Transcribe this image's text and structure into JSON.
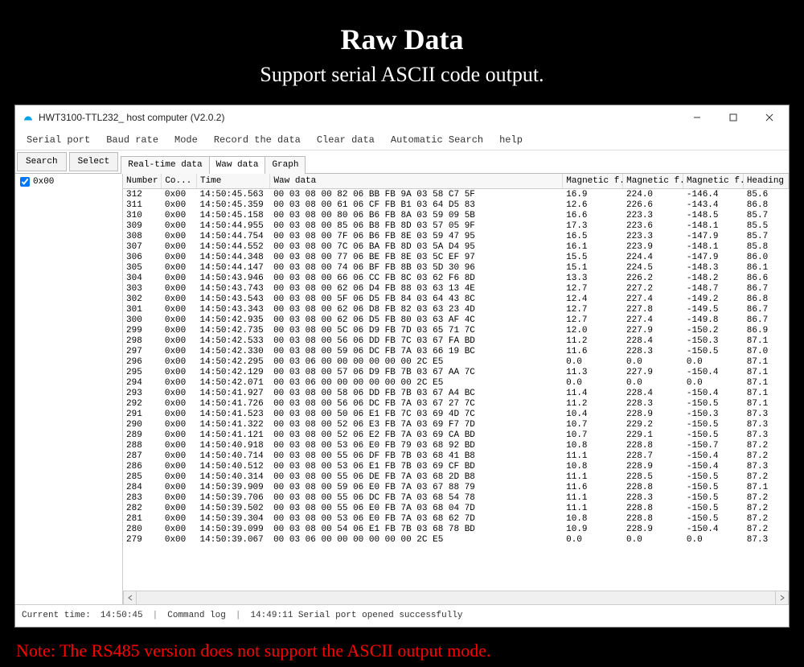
{
  "page": {
    "title": "Raw Data",
    "subtitle": "Support serial ASCII code output.",
    "footer_note": "Note: The RS485 version does not support the ASCII output mode."
  },
  "window": {
    "title": "HWT3100-TTL232_ host computer (V2.0.2)"
  },
  "menu": {
    "serial_port": "Serial port",
    "baud_rate": "Baud rate",
    "mode": "Mode",
    "record": "Record the data",
    "clear": "Clear data",
    "auto_search": "Automatic Search",
    "help": "help"
  },
  "toolbar": {
    "search": "Search",
    "select": "Select"
  },
  "tabs": {
    "realtime": "Real-time data",
    "raw": "Waw data",
    "graph": "Graph"
  },
  "side": {
    "checkbox_label": "0x00",
    "checked": true
  },
  "table": {
    "headers": {
      "number": "Number",
      "co": "Co...",
      "time": "Time",
      "raw": "Waw data",
      "mag1": "Magnetic f...",
      "mag2": "Magnetic f...",
      "mag3": "Magnetic f...",
      "heading": "Heading"
    },
    "rows": [
      {
        "number": "312",
        "co": "0x00",
        "time": "14:50:45.563",
        "raw": "00 03 08 00 82 06 BB FB 9A 03 58 C7 5F",
        "m1": "16.9",
        "m2": "224.0",
        "m3": "-146.4",
        "h": "85.6"
      },
      {
        "number": "311",
        "co": "0x00",
        "time": "14:50:45.359",
        "raw": "00 03 08 00 61 06 CF FB B1 03 64 D5 83",
        "m1": "12.6",
        "m2": "226.6",
        "m3": "-143.4",
        "h": "86.8"
      },
      {
        "number": "310",
        "co": "0x00",
        "time": "14:50:45.158",
        "raw": "00 03 08 00 80 06 B6 FB 8A 03 59 09 5B",
        "m1": "16.6",
        "m2": "223.3",
        "m3": "-148.5",
        "h": "85.7"
      },
      {
        "number": "309",
        "co": "0x00",
        "time": "14:50:44.955",
        "raw": "00 03 08 00 85 06 B8 FB 8D 03 57 05 9F",
        "m1": "17.3",
        "m2": "223.6",
        "m3": "-148.1",
        "h": "85.5"
      },
      {
        "number": "308",
        "co": "0x00",
        "time": "14:50:44.754",
        "raw": "00 03 08 00 7F 06 B6 FB 8E 03 59 47 95",
        "m1": "16.5",
        "m2": "223.3",
        "m3": "-147.9",
        "h": "85.7"
      },
      {
        "number": "307",
        "co": "0x00",
        "time": "14:50:44.552",
        "raw": "00 03 08 00 7C 06 BA FB 8D 03 5A D4 95",
        "m1": "16.1",
        "m2": "223.9",
        "m3": "-148.1",
        "h": "85.8"
      },
      {
        "number": "306",
        "co": "0x00",
        "time": "14:50:44.348",
        "raw": "00 03 08 00 77 06 BE FB 8E 03 5C EF 97",
        "m1": "15.5",
        "m2": "224.4",
        "m3": "-147.9",
        "h": "86.0"
      },
      {
        "number": "305",
        "co": "0x00",
        "time": "14:50:44.147",
        "raw": "00 03 08 00 74 06 BF FB 8B 03 5D 30 96",
        "m1": "15.1",
        "m2": "224.5",
        "m3": "-148.3",
        "h": "86.1"
      },
      {
        "number": "304",
        "co": "0x00",
        "time": "14:50:43.946",
        "raw": "00 03 08 00 66 06 CC FB 8C 03 62 F6 8D",
        "m1": "13.3",
        "m2": "226.2",
        "m3": "-148.2",
        "h": "86.6"
      },
      {
        "number": "303",
        "co": "0x00",
        "time": "14:50:43.743",
        "raw": "00 03 08 00 62 06 D4 FB 88 03 63 13 4E",
        "m1": "12.7",
        "m2": "227.2",
        "m3": "-148.7",
        "h": "86.7"
      },
      {
        "number": "302",
        "co": "0x00",
        "time": "14:50:43.543",
        "raw": "00 03 08 00 5F 06 D5 FB 84 03 64 43 8C",
        "m1": "12.4",
        "m2": "227.4",
        "m3": "-149.2",
        "h": "86.8"
      },
      {
        "number": "301",
        "co": "0x00",
        "time": "14:50:43.343",
        "raw": "00 03 08 00 62 06 D8 FB 82 03 63 23 4D",
        "m1": "12.7",
        "m2": "227.8",
        "m3": "-149.5",
        "h": "86.7"
      },
      {
        "number": "300",
        "co": "0x00",
        "time": "14:50:42.935",
        "raw": "00 03 08 00 62 06 D5 FB 80 03 63 AF 4C",
        "m1": "12.7",
        "m2": "227.4",
        "m3": "-149.8",
        "h": "86.7"
      },
      {
        "number": "299",
        "co": "0x00",
        "time": "14:50:42.735",
        "raw": "00 03 08 00 5C 06 D9 FB 7D 03 65 71 7C",
        "m1": "12.0",
        "m2": "227.9",
        "m3": "-150.2",
        "h": "86.9"
      },
      {
        "number": "298",
        "co": "0x00",
        "time": "14:50:42.533",
        "raw": "00 03 08 00 56 06 DD FB 7C 03 67 FA BD",
        "m1": "11.2",
        "m2": "228.4",
        "m3": "-150.3",
        "h": "87.1"
      },
      {
        "number": "297",
        "co": "0x00",
        "time": "14:50:42.330",
        "raw": "00 03 08 00 59 06 DC FB 7A 03 66 19 BC",
        "m1": "11.6",
        "m2": "228.3",
        "m3": "-150.5",
        "h": "87.0"
      },
      {
        "number": "296",
        "co": "0x00",
        "time": "14:50:42.295",
        "raw": "00 03 06 00 00 00 00 00 00 2C E5",
        "m1": "0.0",
        "m2": "0.0",
        "m3": "0.0",
        "h": "87.1"
      },
      {
        "number": "295",
        "co": "0x00",
        "time": "14:50:42.129",
        "raw": "00 03 08 00 57 06 D9 FB 7B 03 67 AA 7C",
        "m1": "11.3",
        "m2": "227.9",
        "m3": "-150.4",
        "h": "87.1"
      },
      {
        "number": "294",
        "co": "0x00",
        "time": "14:50:42.071",
        "raw": "00 03 06 00 00 00 00 00 00 2C E5",
        "m1": "0.0",
        "m2": "0.0",
        "m3": "0.0",
        "h": "87.1"
      },
      {
        "number": "293",
        "co": "0x00",
        "time": "14:50:41.927",
        "raw": "00 03 08 00 58 06 DD FB 7B 03 67 A4 BC",
        "m1": "11.4",
        "m2": "228.4",
        "m3": "-150.4",
        "h": "87.1"
      },
      {
        "number": "292",
        "co": "0x00",
        "time": "14:50:41.726",
        "raw": "00 03 08 00 56 06 DC FB 7A 03 67 27 7C",
        "m1": "11.2",
        "m2": "228.3",
        "m3": "-150.5",
        "h": "87.1"
      },
      {
        "number": "291",
        "co": "0x00",
        "time": "14:50:41.523",
        "raw": "00 03 08 00 50 06 E1 FB 7C 03 69 4D 7C",
        "m1": "10.4",
        "m2": "228.9",
        "m3": "-150.3",
        "h": "87.3"
      },
      {
        "number": "290",
        "co": "0x00",
        "time": "14:50:41.322",
        "raw": "00 03 08 00 52 06 E3 FB 7A 03 69 F7 7D",
        "m1": "10.7",
        "m2": "229.2",
        "m3": "-150.5",
        "h": "87.3"
      },
      {
        "number": "289",
        "co": "0x00",
        "time": "14:50:41.121",
        "raw": "00 03 08 00 52 06 E2 FB 7A 03 69 CA BD",
        "m1": "10.7",
        "m2": "229.1",
        "m3": "-150.5",
        "h": "87.3"
      },
      {
        "number": "288",
        "co": "0x00",
        "time": "14:50:40.918",
        "raw": "00 03 08 00 53 06 E0 FB 79 03 68 92 BD",
        "m1": "10.8",
        "m2": "228.8",
        "m3": "-150.7",
        "h": "87.2"
      },
      {
        "number": "287",
        "co": "0x00",
        "time": "14:50:40.714",
        "raw": "00 03 08 00 55 06 DF FB 7B 03 68 41 B8",
        "m1": "11.1",
        "m2": "228.7",
        "m3": "-150.4",
        "h": "87.2"
      },
      {
        "number": "286",
        "co": "0x00",
        "time": "14:50:40.512",
        "raw": "00 03 08 00 53 06 E1 FB 7B 03 69 CF BD",
        "m1": "10.8",
        "m2": "228.9",
        "m3": "-150.4",
        "h": "87.3"
      },
      {
        "number": "285",
        "co": "0x00",
        "time": "14:50:40.314",
        "raw": "00 03 08 00 55 06 DE FB 7A 03 68 2D B8",
        "m1": "11.1",
        "m2": "228.5",
        "m3": "-150.5",
        "h": "87.2"
      },
      {
        "number": "284",
        "co": "0x00",
        "time": "14:50:39.909",
        "raw": "00 03 08 00 59 06 E0 FB 7A 03 67 88 79",
        "m1": "11.6",
        "m2": "228.8",
        "m3": "-150.5",
        "h": "87.1"
      },
      {
        "number": "283",
        "co": "0x00",
        "time": "14:50:39.706",
        "raw": "00 03 08 00 55 06 DC FB 7A 03 68 54 78",
        "m1": "11.1",
        "m2": "228.3",
        "m3": "-150.5",
        "h": "87.2"
      },
      {
        "number": "282",
        "co": "0x00",
        "time": "14:50:39.502",
        "raw": "00 03 08 00 55 06 E0 FB 7A 03 68 04 7D",
        "m1": "11.1",
        "m2": "228.8",
        "m3": "-150.5",
        "h": "87.2"
      },
      {
        "number": "281",
        "co": "0x00",
        "time": "14:50:39.304",
        "raw": "00 03 08 00 53 06 E0 FB 7A 03 68 62 7D",
        "m1": "10.8",
        "m2": "228.8",
        "m3": "-150.5",
        "h": "87.2"
      },
      {
        "number": "280",
        "co": "0x00",
        "time": "14:50:39.099",
        "raw": "00 03 08 00 54 06 E1 FB 7B 03 68 78 BD",
        "m1": "10.9",
        "m2": "228.9",
        "m3": "-150.4",
        "h": "87.2"
      },
      {
        "number": "279",
        "co": "0x00",
        "time": "14:50:39.067",
        "raw": "00 03 06 00 00 00 00 00 00 2C E5",
        "m1": "0.0",
        "m2": "0.0",
        "m3": "0.0",
        "h": "87.3"
      }
    ]
  },
  "status": {
    "current_time_label": "Current time:",
    "current_time": "14:50:45",
    "command_log_label": "Command log",
    "command_log": "14:49:11 Serial port opened successfully"
  }
}
